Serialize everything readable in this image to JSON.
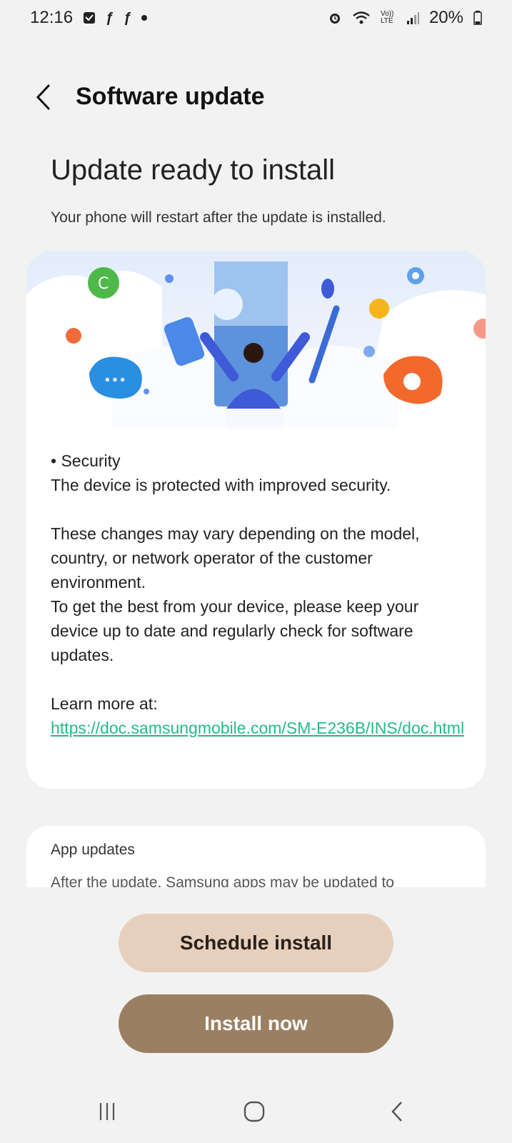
{
  "status_bar": {
    "time": "12:16",
    "battery": "20%",
    "left_icons": [
      "message-icon",
      "app-icon",
      "app-icon",
      "dot-icon"
    ],
    "right_icons": [
      "alarm-icon",
      "wifi-icon",
      "volte-icon",
      "signal-icon",
      "battery-icon"
    ],
    "volte_label": "Vo)) LTE"
  },
  "header": {
    "title": "Software update"
  },
  "main": {
    "headline": "Update ready to install",
    "subline": "Your phone will restart after the update is installed."
  },
  "notes": {
    "bullet": "• Security",
    "bullet_desc": "The device is protected with improved security.",
    "para1": "These changes may vary depending on the model, country, or network operator of the customer environment.",
    "para2": "To get the best from your device, please keep your device up to date and regularly check for software updates.",
    "learn_more": "Learn more at:",
    "link": "https://doc.samsungmobile.com/SM-E236B/INS/doc.html"
  },
  "app_updates": {
    "title": "App updates",
    "partial_text": "After the update, Samsung apps may be updated to"
  },
  "buttons": {
    "schedule": "Schedule install",
    "install": "Install now"
  },
  "colors": {
    "link": "#27b98a",
    "schedule_bg": "#e6d0bd",
    "install_bg": "#9b7f62"
  }
}
